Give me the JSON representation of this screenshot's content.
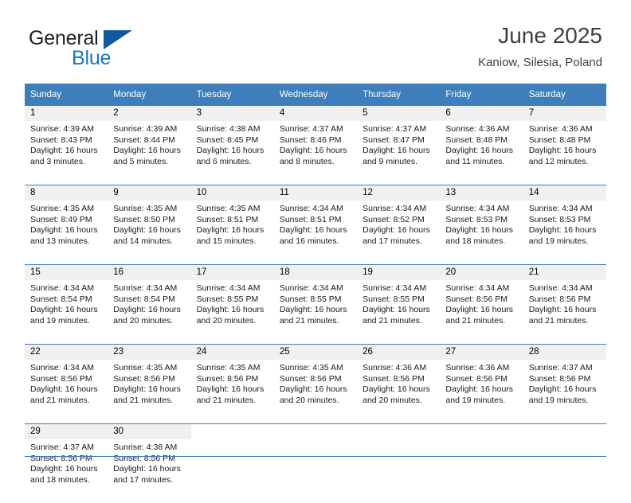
{
  "brand": {
    "name_part1": "General",
    "name_part2": "Blue",
    "flag_icon": "triangle-flag-icon",
    "accent_color": "#1a76bc",
    "flag_color": "#11589f"
  },
  "header": {
    "title": "June 2025",
    "location": "Kaniow, Silesia, Poland"
  },
  "theme": {
    "header_bg": "#3d7ebb",
    "header_text": "#ffffff",
    "daynum_bg": "#f0f0f0",
    "cell_bg": "#ffffff",
    "rule_color": "#3d7ebb"
  },
  "weekday_headers": [
    "Sunday",
    "Monday",
    "Tuesday",
    "Wednesday",
    "Thursday",
    "Friday",
    "Saturday"
  ],
  "weeks": [
    {
      "days": [
        {
          "number": "1",
          "sunrise": "Sunrise: 4:39 AM",
          "sunset": "Sunset: 8:43 PM",
          "daylight_line1": "Daylight: 16 hours",
          "daylight_line2": "and 3 minutes."
        },
        {
          "number": "2",
          "sunrise": "Sunrise: 4:39 AM",
          "sunset": "Sunset: 8:44 PM",
          "daylight_line1": "Daylight: 16 hours",
          "daylight_line2": "and 5 minutes."
        },
        {
          "number": "3",
          "sunrise": "Sunrise: 4:38 AM",
          "sunset": "Sunset: 8:45 PM",
          "daylight_line1": "Daylight: 16 hours",
          "daylight_line2": "and 6 minutes."
        },
        {
          "number": "4",
          "sunrise": "Sunrise: 4:37 AM",
          "sunset": "Sunset: 8:46 PM",
          "daylight_line1": "Daylight: 16 hours",
          "daylight_line2": "and 8 minutes."
        },
        {
          "number": "5",
          "sunrise": "Sunrise: 4:37 AM",
          "sunset": "Sunset: 8:47 PM",
          "daylight_line1": "Daylight: 16 hours",
          "daylight_line2": "and 9 minutes."
        },
        {
          "number": "6",
          "sunrise": "Sunrise: 4:36 AM",
          "sunset": "Sunset: 8:48 PM",
          "daylight_line1": "Daylight: 16 hours",
          "daylight_line2": "and 11 minutes."
        },
        {
          "number": "7",
          "sunrise": "Sunrise: 4:36 AM",
          "sunset": "Sunset: 8:48 PM",
          "daylight_line1": "Daylight: 16 hours",
          "daylight_line2": "and 12 minutes."
        }
      ]
    },
    {
      "days": [
        {
          "number": "8",
          "sunrise": "Sunrise: 4:35 AM",
          "sunset": "Sunset: 8:49 PM",
          "daylight_line1": "Daylight: 16 hours",
          "daylight_line2": "and 13 minutes."
        },
        {
          "number": "9",
          "sunrise": "Sunrise: 4:35 AM",
          "sunset": "Sunset: 8:50 PM",
          "daylight_line1": "Daylight: 16 hours",
          "daylight_line2": "and 14 minutes."
        },
        {
          "number": "10",
          "sunrise": "Sunrise: 4:35 AM",
          "sunset": "Sunset: 8:51 PM",
          "daylight_line1": "Daylight: 16 hours",
          "daylight_line2": "and 15 minutes."
        },
        {
          "number": "11",
          "sunrise": "Sunrise: 4:34 AM",
          "sunset": "Sunset: 8:51 PM",
          "daylight_line1": "Daylight: 16 hours",
          "daylight_line2": "and 16 minutes."
        },
        {
          "number": "12",
          "sunrise": "Sunrise: 4:34 AM",
          "sunset": "Sunset: 8:52 PM",
          "daylight_line1": "Daylight: 16 hours",
          "daylight_line2": "and 17 minutes."
        },
        {
          "number": "13",
          "sunrise": "Sunrise: 4:34 AM",
          "sunset": "Sunset: 8:53 PM",
          "daylight_line1": "Daylight: 16 hours",
          "daylight_line2": "and 18 minutes."
        },
        {
          "number": "14",
          "sunrise": "Sunrise: 4:34 AM",
          "sunset": "Sunset: 8:53 PM",
          "daylight_line1": "Daylight: 16 hours",
          "daylight_line2": "and 19 minutes."
        }
      ]
    },
    {
      "days": [
        {
          "number": "15",
          "sunrise": "Sunrise: 4:34 AM",
          "sunset": "Sunset: 8:54 PM",
          "daylight_line1": "Daylight: 16 hours",
          "daylight_line2": "and 19 minutes."
        },
        {
          "number": "16",
          "sunrise": "Sunrise: 4:34 AM",
          "sunset": "Sunset: 8:54 PM",
          "daylight_line1": "Daylight: 16 hours",
          "daylight_line2": "and 20 minutes."
        },
        {
          "number": "17",
          "sunrise": "Sunrise: 4:34 AM",
          "sunset": "Sunset: 8:55 PM",
          "daylight_line1": "Daylight: 16 hours",
          "daylight_line2": "and 20 minutes."
        },
        {
          "number": "18",
          "sunrise": "Sunrise: 4:34 AM",
          "sunset": "Sunset: 8:55 PM",
          "daylight_line1": "Daylight: 16 hours",
          "daylight_line2": "and 21 minutes."
        },
        {
          "number": "19",
          "sunrise": "Sunrise: 4:34 AM",
          "sunset": "Sunset: 8:55 PM",
          "daylight_line1": "Daylight: 16 hours",
          "daylight_line2": "and 21 minutes."
        },
        {
          "number": "20",
          "sunrise": "Sunrise: 4:34 AM",
          "sunset": "Sunset: 8:56 PM",
          "daylight_line1": "Daylight: 16 hours",
          "daylight_line2": "and 21 minutes."
        },
        {
          "number": "21",
          "sunrise": "Sunrise: 4:34 AM",
          "sunset": "Sunset: 8:56 PM",
          "daylight_line1": "Daylight: 16 hours",
          "daylight_line2": "and 21 minutes."
        }
      ]
    },
    {
      "days": [
        {
          "number": "22",
          "sunrise": "Sunrise: 4:34 AM",
          "sunset": "Sunset: 8:56 PM",
          "daylight_line1": "Daylight: 16 hours",
          "daylight_line2": "and 21 minutes."
        },
        {
          "number": "23",
          "sunrise": "Sunrise: 4:35 AM",
          "sunset": "Sunset: 8:56 PM",
          "daylight_line1": "Daylight: 16 hours",
          "daylight_line2": "and 21 minutes."
        },
        {
          "number": "24",
          "sunrise": "Sunrise: 4:35 AM",
          "sunset": "Sunset: 8:56 PM",
          "daylight_line1": "Daylight: 16 hours",
          "daylight_line2": "and 21 minutes."
        },
        {
          "number": "25",
          "sunrise": "Sunrise: 4:35 AM",
          "sunset": "Sunset: 8:56 PM",
          "daylight_line1": "Daylight: 16 hours",
          "daylight_line2": "and 20 minutes."
        },
        {
          "number": "26",
          "sunrise": "Sunrise: 4:36 AM",
          "sunset": "Sunset: 8:56 PM",
          "daylight_line1": "Daylight: 16 hours",
          "daylight_line2": "and 20 minutes."
        },
        {
          "number": "27",
          "sunrise": "Sunrise: 4:36 AM",
          "sunset": "Sunset: 8:56 PM",
          "daylight_line1": "Daylight: 16 hours",
          "daylight_line2": "and 19 minutes."
        },
        {
          "number": "28",
          "sunrise": "Sunrise: 4:37 AM",
          "sunset": "Sunset: 8:56 PM",
          "daylight_line1": "Daylight: 16 hours",
          "daylight_line2": "and 19 minutes."
        }
      ]
    },
    {
      "days": [
        {
          "number": "29",
          "sunrise": "Sunrise: 4:37 AM",
          "sunset": "Sunset: 8:56 PM",
          "daylight_line1": "Daylight: 16 hours",
          "daylight_line2": "and 18 minutes."
        },
        {
          "number": "30",
          "sunrise": "Sunrise: 4:38 AM",
          "sunset": "Sunset: 8:56 PM",
          "daylight_line1": "Daylight: 16 hours",
          "daylight_line2": "and 17 minutes."
        },
        {
          "number": "",
          "sunrise": "",
          "sunset": "",
          "daylight_line1": "",
          "daylight_line2": ""
        },
        {
          "number": "",
          "sunrise": "",
          "sunset": "",
          "daylight_line1": "",
          "daylight_line2": ""
        },
        {
          "number": "",
          "sunrise": "",
          "sunset": "",
          "daylight_line1": "",
          "daylight_line2": ""
        },
        {
          "number": "",
          "sunrise": "",
          "sunset": "",
          "daylight_line1": "",
          "daylight_line2": ""
        },
        {
          "number": "",
          "sunrise": "",
          "sunset": "",
          "daylight_line1": "",
          "daylight_line2": ""
        }
      ]
    }
  ]
}
